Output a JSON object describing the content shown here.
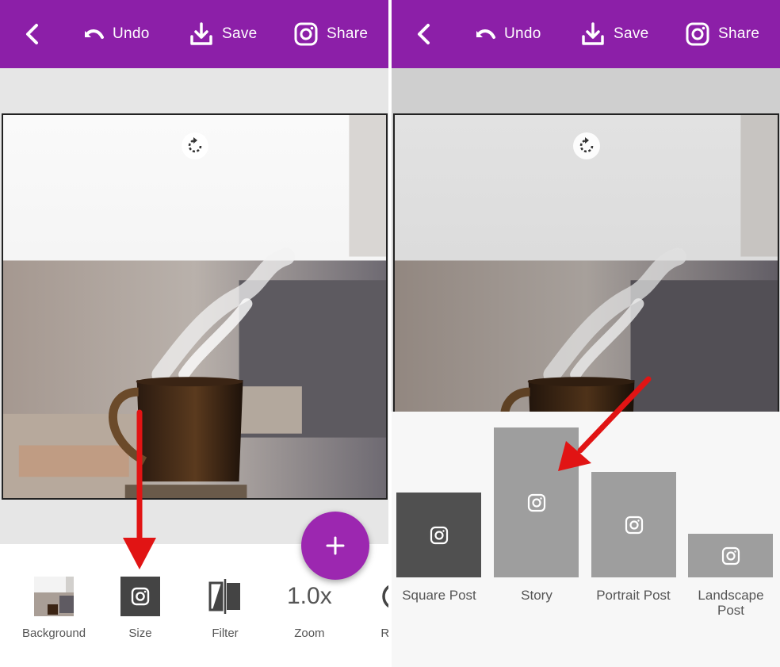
{
  "toolbar": {
    "back_icon": "chevron-left-icon",
    "undo_label": "Undo",
    "save_label": "Save",
    "share_label": "Share",
    "bar_color": "#8c1fa8"
  },
  "bottom_tools": {
    "background_label": "Background",
    "size_label": "Size",
    "filter_label": "Filter",
    "zoom_value": "1.0x",
    "zoom_label": "Zoom",
    "rotate_label": "Rot"
  },
  "fab": {
    "icon": "plus-icon",
    "color": "#9c27b0"
  },
  "size_options": {
    "square_label": "Square Post",
    "story_label": "Story",
    "portrait_label": "Portrait Post",
    "landscape_label": "Landscape Post"
  },
  "annotations": {
    "arrow_color": "#e11414"
  }
}
